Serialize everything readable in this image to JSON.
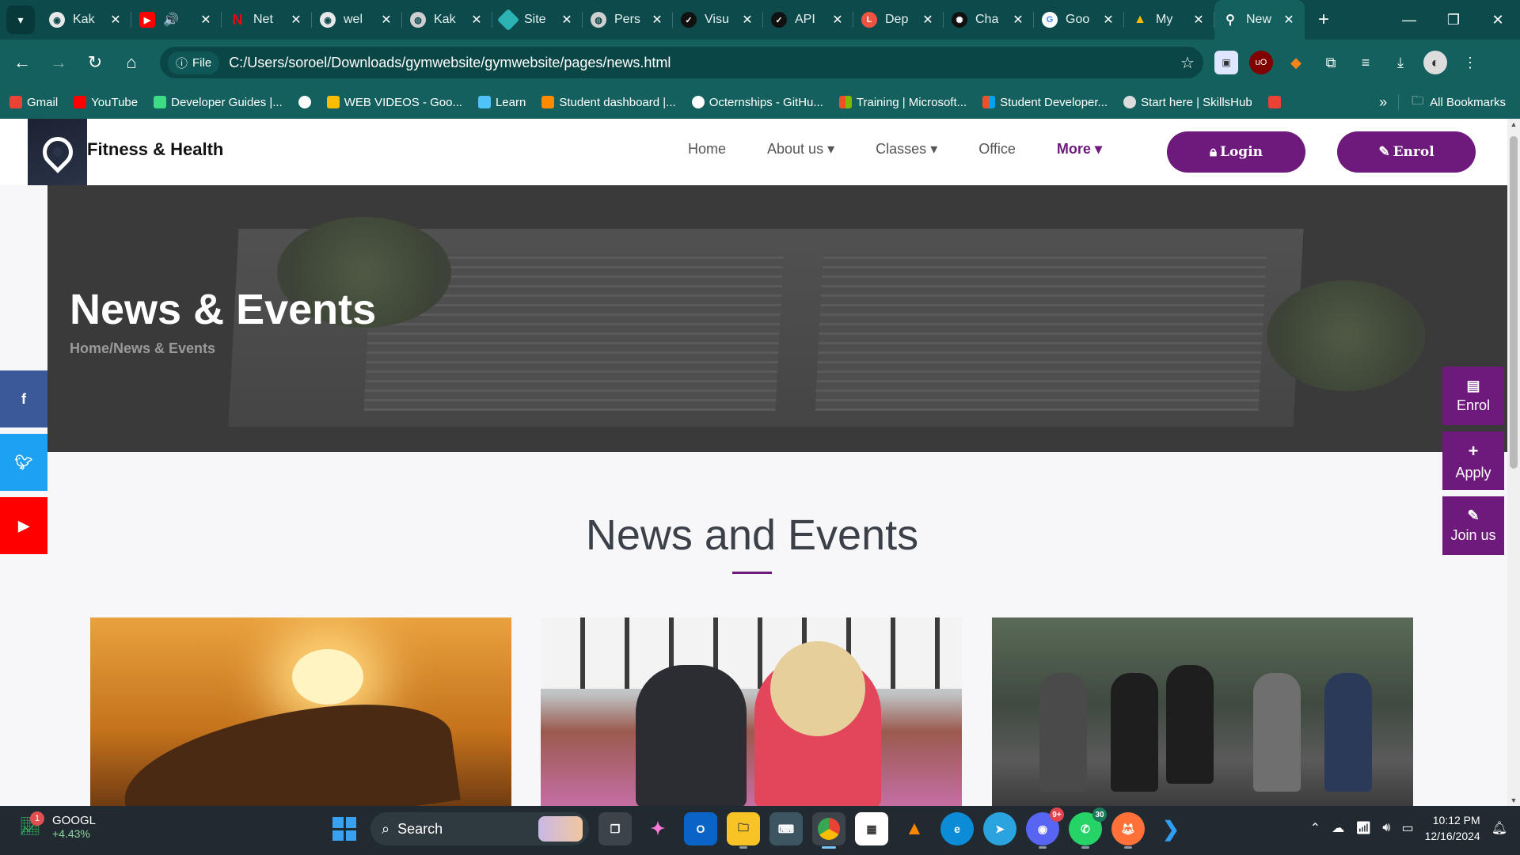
{
  "browser": {
    "tabs": [
      {
        "label": "Kak",
        "icon": "github-icon"
      },
      {
        "label": "",
        "icon": "youtube-icon"
      },
      {
        "label": "Net",
        "icon": "netflix-icon"
      },
      {
        "label": "wel",
        "icon": "github-icon"
      },
      {
        "label": "Kak",
        "icon": "globe-icon"
      },
      {
        "label": "Site",
        "icon": "diamond-icon"
      },
      {
        "label": "Pers",
        "icon": "globe-icon"
      },
      {
        "label": "Visu",
        "icon": "check-circle-icon"
      },
      {
        "label": "API",
        "icon": "check-circle-icon"
      },
      {
        "label": "Dep",
        "icon": "laravel-icon"
      },
      {
        "label": "Cha",
        "icon": "chatgpt-icon"
      },
      {
        "label": "Goo",
        "icon": "google-icon"
      },
      {
        "label": "My",
        "icon": "drive-icon"
      },
      {
        "label": "New",
        "icon": "location-pin-icon",
        "active": true
      }
    ],
    "address": {
      "chip": "File",
      "url": "C:/Users/soroel/Downloads/gymwebsite/gymwebsite/pages/news.html"
    },
    "bookmarks": [
      {
        "label": "Gmail",
        "color": "#ea4335"
      },
      {
        "label": "YouTube",
        "color": "#ff0000"
      },
      {
        "label": "Developer Guides |...",
        "color": "#3ddc84"
      },
      {
        "label": "",
        "color": "#ffffff"
      },
      {
        "label": "WEB VIDEOS - Goo...",
        "color": "#fbbc04"
      },
      {
        "label": "Learn",
        "color": "#4fc3f7"
      },
      {
        "label": "Student dashboard |...",
        "color": "#ff8a00"
      },
      {
        "label": "Octernships - GitHu...",
        "color": "#ffffff"
      },
      {
        "label": "Training | Microsoft...",
        "color": "#f25022"
      },
      {
        "label": "Student Developer...",
        "color": "#f25022"
      },
      {
        "label": "Start here | SkillsHub",
        "color": "#dddddd"
      }
    ],
    "all_bookmarks": "All Bookmarks"
  },
  "site": {
    "brand": "Fitness & Health",
    "nav": {
      "home": "Home",
      "about": "About us",
      "classes": "Classes",
      "office": "Office",
      "more": "More"
    },
    "login": "Login",
    "enrol": "Enrol",
    "hero": {
      "title": "News & Events",
      "breadcrumb": "Home/News & Events"
    },
    "section_title": "News and Events",
    "side_actions": {
      "enrol": "Enrol",
      "apply": "Apply",
      "join": "Join us"
    },
    "social": [
      "facebook-icon",
      "twitter-icon",
      "youtube-icon"
    ]
  },
  "taskbar": {
    "stock": {
      "ticker": "GOOGL",
      "change": "+4.43%",
      "badge": "1"
    },
    "search": "Search",
    "whatsapp_count": "30",
    "discord_count": "9+",
    "time": "10:12 PM",
    "date": "12/16/2024"
  },
  "colors": {
    "accent": "#6e1a7c",
    "browser_frame": "#14605f"
  }
}
